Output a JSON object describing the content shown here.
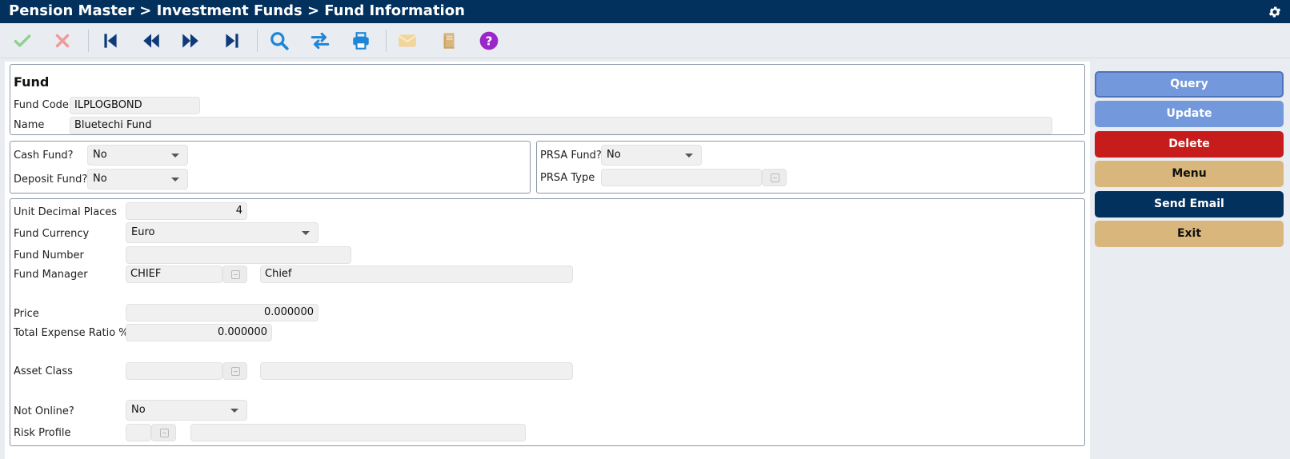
{
  "window": {
    "breadcrumb": "Pension Master > Investment Funds > Fund Information"
  },
  "icons": {
    "settings": "gear-icon",
    "toolbar": [
      "check-icon",
      "close-icon",
      "first-record-icon",
      "previous-record-icon",
      "next-record-icon",
      "last-record-icon",
      "search-icon",
      "swap-icon",
      "print-icon",
      "mail-icon",
      "notebook-icon",
      "help-icon"
    ]
  },
  "colors": {
    "header": "#03315e",
    "query": "#7398dc",
    "delete": "#c61c1c",
    "menu": "#d9b77c",
    "send_email": "#03315e"
  },
  "fund": {
    "heading": "Fund",
    "code_label": "Fund Code",
    "code_value": "ILPLOGBOND",
    "name_label": "Name",
    "name_value": "Bluetechi Fund"
  },
  "flags": {
    "cash_label": "Cash Fund?",
    "cash_value": "No",
    "deposit_label": "Deposit Fund?",
    "deposit_value": "No",
    "prsa_fund_label": "PRSA Fund?",
    "prsa_fund_value": "No",
    "prsa_type_label": "PRSA Type",
    "prsa_type_value": ""
  },
  "details": {
    "unit_decimal_label": "Unit Decimal Places",
    "unit_decimal_value": "4",
    "currency_label": "Fund Currency",
    "currency_value": "Euro",
    "fund_number_label": "Fund Number",
    "fund_number_value": "",
    "manager_label": "Fund Manager",
    "manager_code": "CHIEF",
    "manager_name": "Chief",
    "price_label": "Price",
    "price_value": "0.000000",
    "ter_label": "Total Expense Ratio %",
    "ter_value": "0.000000",
    "asset_class_label": "Asset Class",
    "asset_class_code": "",
    "asset_class_desc": "",
    "not_online_label": "Not Online?",
    "not_online_value": "No",
    "risk_profile_label": "Risk Profile",
    "risk_profile_code": "",
    "risk_profile_desc": ""
  },
  "actions": {
    "query": "Query",
    "update": "Update",
    "delete": "Delete",
    "menu": "Menu",
    "send_email": "Send Email",
    "exit": "Exit"
  }
}
